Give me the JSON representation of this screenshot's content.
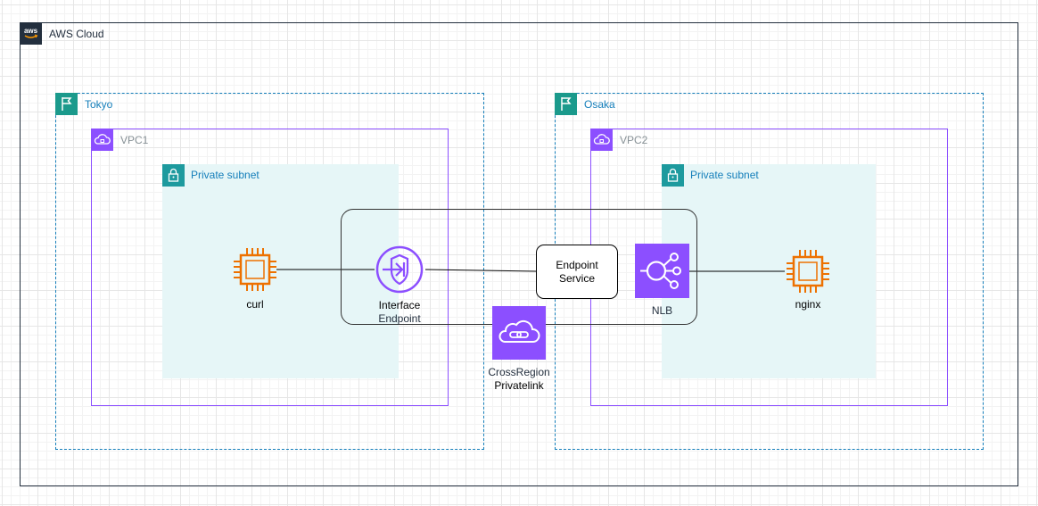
{
  "groups": {
    "aws_cloud": "AWS Cloud",
    "tokyo_region": "Tokyo",
    "osaka_region": "Osaka",
    "vpc1": "VPC1",
    "vpc2": "VPC2",
    "subnet_left": "Private subnet",
    "subnet_right": "Private subnet"
  },
  "nodes": {
    "curl": "curl",
    "interface_endpoint": {
      "line1": "Interface",
      "line2": "Endpoint"
    },
    "endpoint_service": {
      "line1": "Endpoint",
      "line2": "Service"
    },
    "nlb": "NLB",
    "nginx": "nginx",
    "crossregion": {
      "line1": "CrossRegion",
      "line2": "Privatelink"
    }
  },
  "colors": {
    "compute": "#ed7100",
    "networking": "#8c4fff",
    "region_border": "#147eba",
    "region_tag": "#1b9a8c",
    "subnet_fill": "#e6f6f7",
    "aws_cloud_tag": "#232f3e"
  },
  "icons": [
    "aws-logo-icon",
    "region-flag-icon",
    "vpc-cloud-icon",
    "lock-icon",
    "ec2-instance-icon",
    "vpc-endpoint-icon",
    "nlb-icon",
    "privatelink-icon"
  ]
}
